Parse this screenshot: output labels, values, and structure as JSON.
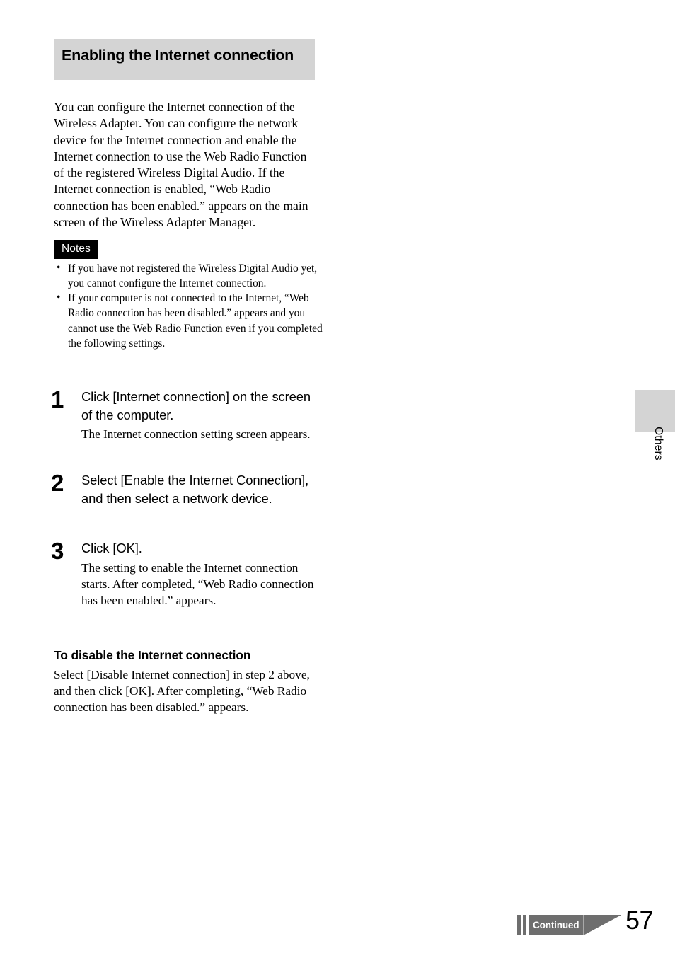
{
  "section": {
    "heading": "Enabling the Internet connection",
    "intro": "You can configure the Internet connection of the Wireless Adapter. You can configure the network device for the Internet connection and enable the Internet connection to use the Web Radio Function of the registered Wireless Digital Audio. If the Internet connection is enabled, “Web Radio connection has been enabled.” appears on the main screen of the Wireless Adapter Manager."
  },
  "notes": {
    "badge_label": "Notes",
    "bullet_glyph": "•",
    "items": [
      "If you have not registered the Wireless Digital Audio yet, you cannot configure the Internet connection.",
      "If your computer is not connected to the Internet, “Web Radio connection has been disabled.” appears and you cannot use the Web Radio Function even if you completed the following settings."
    ]
  },
  "steps": [
    {
      "number": "1",
      "lead": "Click [Internet connection] on the screen of the computer.",
      "detail": "The Internet connection setting screen appears."
    },
    {
      "number": "2",
      "lead": "Select [Enable the Internet Connection], and then select a network device.",
      "detail": ""
    },
    {
      "number": "3",
      "lead": "Click [OK].",
      "detail": "The setting to enable the Internet connection starts. After completed, “Web Radio connection has been enabled.” appears."
    }
  ],
  "subsection": {
    "heading": "To disable the Internet connection",
    "body": "Select [Disable Internet connection] in step 2 above, and then click [OK]. After completing, “Web Radio connection has been disabled.” appears."
  },
  "edge_tab": {
    "label": "Others"
  },
  "footer": {
    "continued_label": "Continued",
    "page_number": "57"
  },
  "colors": {
    "heading_band": "#d4d4d4",
    "notes_badge_bg": "#000000",
    "continued_marker": "#6e6e6e",
    "edge_tab": "#d4d4d4"
  }
}
